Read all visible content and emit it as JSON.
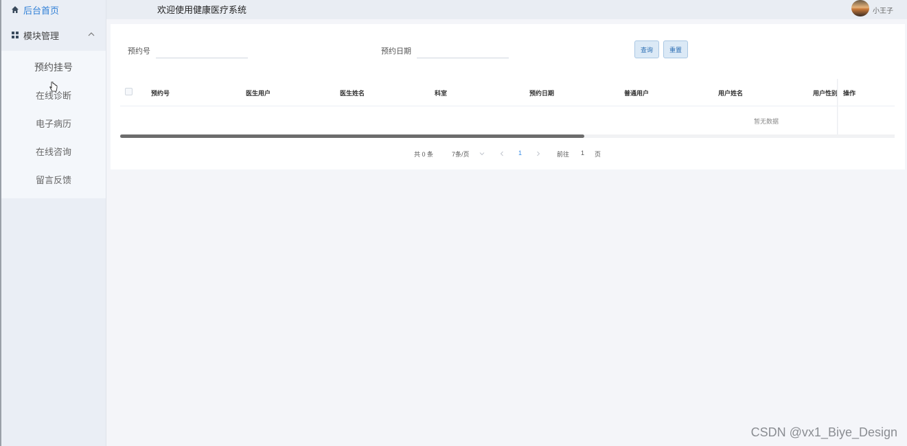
{
  "sidebar": {
    "home_label": "后台首页",
    "group_label": "模块管理",
    "items": [
      {
        "label": "预约挂号"
      },
      {
        "label": "在线诊断"
      },
      {
        "label": "电子病历"
      },
      {
        "label": "在线咨询"
      },
      {
        "label": "留言反馈"
      }
    ]
  },
  "header": {
    "welcome": "欢迎使用健康医疗系统",
    "username": "小王子"
  },
  "search": {
    "field1_label": "预约号",
    "field1_value": "",
    "field2_label": "预约日期",
    "field2_value": "",
    "query_button": "查询",
    "reset_button": "重置"
  },
  "table": {
    "columns": [
      "预约号",
      "医生用户",
      "医生姓名",
      "科室",
      "预约日期",
      "普通用户",
      "用户姓名",
      "用户性别"
    ],
    "action_column": "操作",
    "empty_text": "暂无数据"
  },
  "pagination": {
    "total": "共 0 条",
    "page_size": "7条/页",
    "current_page": "1",
    "goto_label": "前往",
    "goto_value": "1",
    "page_suffix": "页"
  },
  "watermark": "CSDN @vx1_Biye_Design",
  "colors": {
    "accent": "#2f7fd6",
    "sidebar_bg": "#eaeef5",
    "page_bg": "#f4f5f9"
  }
}
